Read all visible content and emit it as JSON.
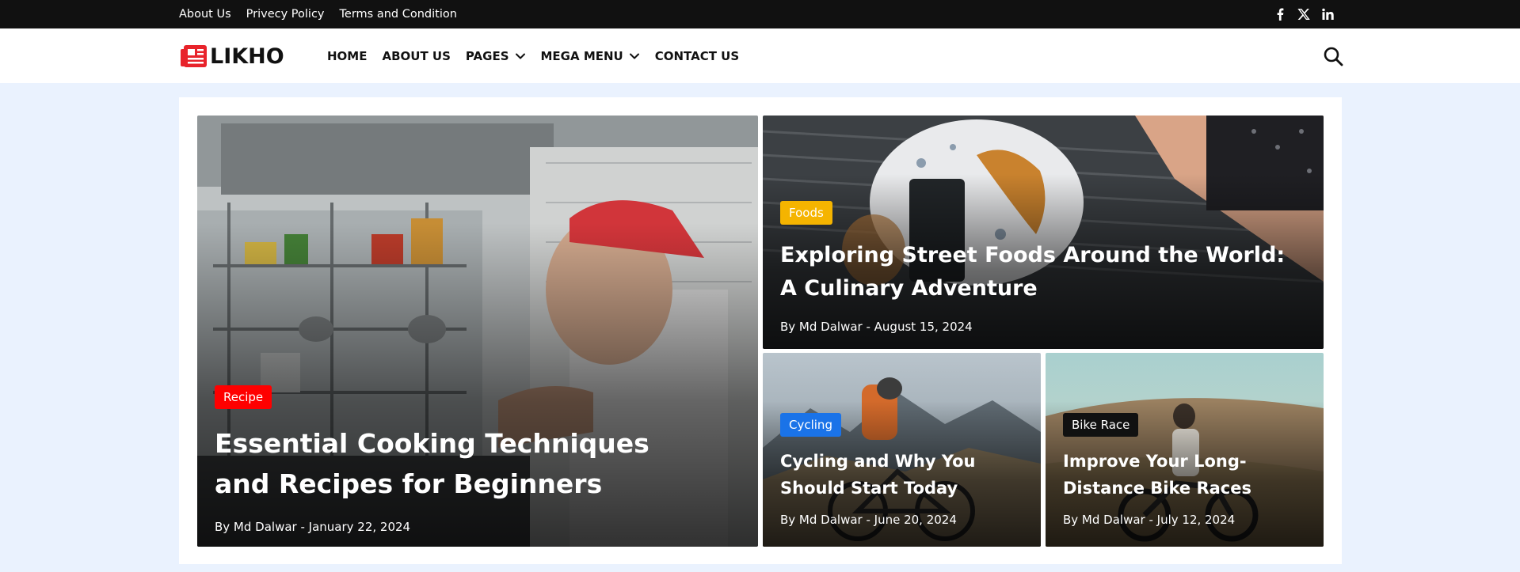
{
  "topbar": {
    "links": [
      "About Us",
      "Privecy Policy",
      "Terms and Condition"
    ],
    "socials": [
      "facebook-icon",
      "x-twitter-icon",
      "linkedin-icon"
    ]
  },
  "brand": {
    "name": "LIKHO",
    "accent": "#e8232b"
  },
  "nav": {
    "items": [
      {
        "label": "HOME",
        "dropdown": false
      },
      {
        "label": "ABOUT US",
        "dropdown": false
      },
      {
        "label": "PAGES",
        "dropdown": true
      },
      {
        "label": "MEGA MENU",
        "dropdown": true
      },
      {
        "label": "CONTACT US",
        "dropdown": false
      }
    ],
    "search_icon": "search-icon"
  },
  "posts": [
    {
      "category": "Recipe",
      "badge_color": "#ff0000",
      "title": "Essential Cooking Techniques and Recipes for Beginners",
      "meta": "By Md Dalwar - January 22, 2024"
    },
    {
      "category": "Foods",
      "badge_color": "#f5b400",
      "title": "Exploring Street Foods Around the World: A Culinary Adventure",
      "meta": "By Md Dalwar - August 15, 2024"
    },
    {
      "category": "Cycling",
      "badge_color": "#1a73e8",
      "title": "Cycling and Why You Should Start Today",
      "meta": "By Md Dalwar - June 20, 2024"
    },
    {
      "category": "Bike Race",
      "badge_color": "#111111",
      "title": "Improve Your Long-Distance Bike Races",
      "meta": "By Md Dalwar - July 12, 2024"
    }
  ]
}
